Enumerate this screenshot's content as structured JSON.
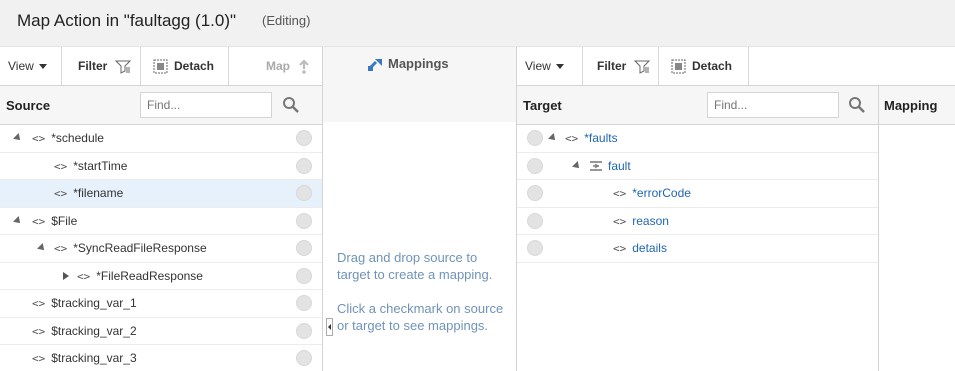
{
  "header": {
    "title": "Map Action in \"faultagg (1.0)\"",
    "status": "(Editing)"
  },
  "source": {
    "toolbar": {
      "view": "View",
      "filter": "Filter",
      "detach": "Detach",
      "map": "Map"
    },
    "column_label": "Source",
    "find_placeholder": "Find...",
    "rows": [
      {
        "label": "*schedule",
        "expand": "expanded"
      },
      {
        "label": "*startTime"
      },
      {
        "label": "*filename",
        "selected": true
      },
      {
        "label": "$File",
        "expand": "expanded"
      },
      {
        "label": "*SyncReadFileResponse",
        "expand": "expanded"
      },
      {
        "label": "*FileReadResponse",
        "expand": "collapsed"
      },
      {
        "label": "$tracking_var_1"
      },
      {
        "label": "$tracking_var_2"
      },
      {
        "label": "$tracking_var_3"
      }
    ]
  },
  "mappings": {
    "title": "Mappings",
    "hint1": "Drag and drop source to target to create a mapping.",
    "hint2": "Click a checkmark on source or target to see mappings."
  },
  "target": {
    "toolbar": {
      "view": "View",
      "filter": "Filter",
      "detach": "Detach"
    },
    "column_label": "Target",
    "find_placeholder": "Find...",
    "mapping_label": "Mapping",
    "rows": [
      {
        "label": "*faults",
        "expand": "expanded"
      },
      {
        "label": "fault",
        "expand": "expanded"
      },
      {
        "label": "*errorCode"
      },
      {
        "label": "reason"
      },
      {
        "label": "details"
      }
    ]
  }
}
